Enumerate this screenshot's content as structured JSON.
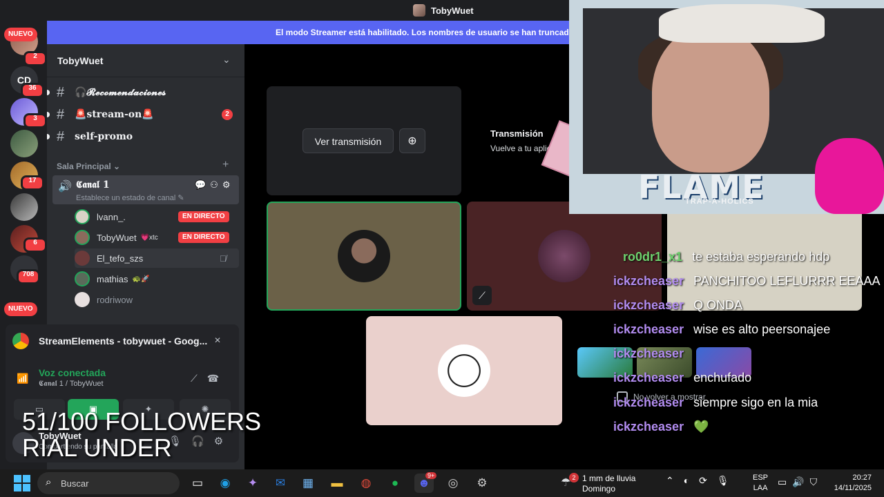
{
  "window": {
    "title": "TobyWuet"
  },
  "rail": {
    "badges": [
      "2",
      "36",
      "3",
      "17",
      "6",
      "708"
    ],
    "new_label": "NUEVO",
    "cd_label": "CD"
  },
  "banner": {
    "text": "El modo Streamer está habilitado. Los nombres de usuario se han truncado"
  },
  "guild": {
    "name": "TobyWuet"
  },
  "channels": [
    {
      "name": "🎧𝓡𝓮𝓬𝓸𝓶𝓮𝓷𝓭𝓪𝓬𝓲𝓸𝓷𝓮𝓼",
      "unread": ""
    },
    {
      "name": "🚨stream-on🚨",
      "unread": "2"
    },
    {
      "name": "self-promo",
      "unread": ""
    }
  ],
  "category": {
    "name": "Sala Principal"
  },
  "voice_channel": {
    "name": "𝕮𝖆𝖓𝖆𝖑 1",
    "status": "Establece un estado de canal"
  },
  "members": [
    {
      "name": "lvann_.",
      "badge": "EN DIRECTO",
      "tag": ""
    },
    {
      "name": "TobyWuet",
      "badge": "EN DIRECTO",
      "tag": "💗xtc"
    },
    {
      "name": "El_tefo_szs",
      "badge": "",
      "tag": ""
    },
    {
      "name": "mathias",
      "badge": "",
      "tag": "🐢🚀"
    },
    {
      "name": "rodriwow",
      "badge": "",
      "tag": ""
    }
  ],
  "panel": {
    "activity": "StreamElements - tobywuet - Goog...",
    "voice_status": "Voz conectada",
    "voice_sub": "𝕮𝖆𝖓𝖆𝖑 1 / TobyWuet",
    "user_name": "TobyWuet",
    "user_sub": "Compartiendo su pantalla"
  },
  "stage": {
    "watch_label": "Ver transmisión",
    "transmission_title": "Transmisión",
    "transmission_sub": "Vuelve a tu aplica"
  },
  "webcam": {
    "brand": "FLAME",
    "brand_sub": "TRAP-A-HOLICS"
  },
  "chat": [
    {
      "user": "ro0dr1_x1",
      "msg": "te estaba esperando hdp",
      "color": "green"
    },
    {
      "user": "ickzcheaser",
      "msg": "PANCHITOO LEFLURRR EEAAA",
      "color": "purple"
    },
    {
      "user": "ickzcheaser",
      "msg": "Q ONDA",
      "color": "purple"
    },
    {
      "user": "ickzcheaser",
      "msg": "wise es alto peersonajee",
      "color": "purple"
    },
    {
      "user": "ickzcheaser",
      "msg": "",
      "color": "purple"
    },
    {
      "user": "ickzcheaser",
      "msg": "enchufado",
      "color": "purple"
    },
    {
      "user": "ickzcheaser",
      "msg": "siempre sigo en la mia",
      "color": "purple"
    },
    {
      "user": "ickzcheaser",
      "msg": "💚",
      "color": "purple"
    }
  ],
  "no_volver": "No volver a mostrar",
  "followers": {
    "line1": "51/100 FOLLOWERS",
    "line2": "RIAL UNDER"
  },
  "taskbar": {
    "search_placeholder": "Buscar",
    "weather_count": "2",
    "weather_line1": "1 mm de lluvia",
    "weather_line2": "Domingo",
    "lang1": "ESP",
    "lang2": "LAA",
    "time": "20:27",
    "date": "14/11/2025",
    "discord_badge": "9+"
  },
  "colors": {
    "blurple": "#5865f2",
    "green": "#23a55a",
    "red": "#f23f43",
    "sidebar": "#2b2d31"
  }
}
